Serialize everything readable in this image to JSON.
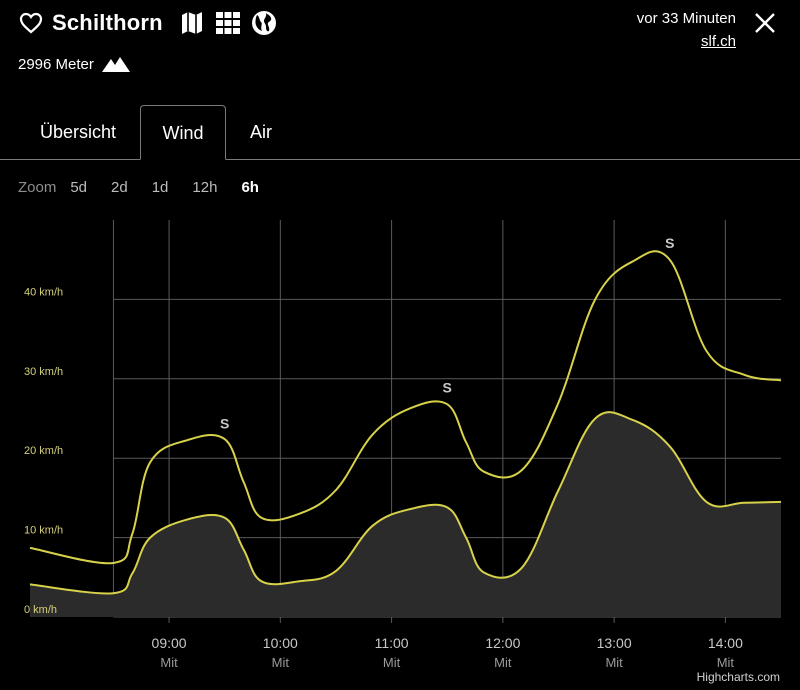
{
  "header": {
    "station_name": "Schilthorn",
    "altitude": "2996 Meter",
    "updated": "vor 33 Minuten",
    "source_link": "slf.ch",
    "icons": [
      "heart-icon",
      "map-icon",
      "grid-icon",
      "globe-icon",
      "mountain-icon",
      "close-icon"
    ]
  },
  "tabs": [
    {
      "label": "Übersicht",
      "active": false
    },
    {
      "label": "Wind",
      "active": true
    },
    {
      "label": "Air",
      "active": false
    }
  ],
  "zoom": {
    "label": "Zoom",
    "options": [
      "5d",
      "2d",
      "1d",
      "12h",
      "6h"
    ],
    "active": "6h"
  },
  "credits": "Highcharts.com",
  "colors": {
    "line": "#d8d24a",
    "area": "#2b2b2b",
    "grid": "#5a5a5a",
    "axis_text": "#d6d07a"
  },
  "chart_data": {
    "type": "line",
    "x_unit": "time",
    "x_ticks": [
      {
        "main": "09:00",
        "sub": "Mit"
      },
      {
        "main": "10:00",
        "sub": "Mit"
      },
      {
        "main": "11:00",
        "sub": "Mit"
      },
      {
        "main": "12:00",
        "sub": "Mit"
      },
      {
        "main": "13:00",
        "sub": "Mit"
      },
      {
        "main": "14:00",
        "sub": "Mit"
      }
    ],
    "x_ticks_hours": [
      9,
      10,
      11,
      12,
      13,
      14
    ],
    "xlim_hours": [
      7.75,
      14.5
    ],
    "y_ticks": [
      {
        "value": 0,
        "label": "0 km/h"
      },
      {
        "value": 10,
        "label": "10 km/h"
      },
      {
        "value": 20,
        "label": "20 km/h"
      },
      {
        "value": 30,
        "label": "30 km/h"
      },
      {
        "value": 40,
        "label": "40 km/h"
      }
    ],
    "ylim": [
      0,
      50
    ],
    "grid": true,
    "series": [
      {
        "kind": "gust",
        "points": [
          [
            7.75,
            8.7
          ],
          [
            8.5,
            6.8
          ],
          [
            8.67,
            10.5
          ],
          [
            8.83,
            19.5
          ],
          [
            9.17,
            22.3
          ],
          [
            9.5,
            22.4
          ],
          [
            9.67,
            17.0
          ],
          [
            9.83,
            12.5
          ],
          [
            10.17,
            13.0
          ],
          [
            10.5,
            16.0
          ],
          [
            10.83,
            23.0
          ],
          [
            11.17,
            26.3
          ],
          [
            11.5,
            26.8
          ],
          [
            11.67,
            22.0
          ],
          [
            11.83,
            18.3
          ],
          [
            12.17,
            18.5
          ],
          [
            12.5,
            27.0
          ],
          [
            12.83,
            40.0
          ],
          [
            13.17,
            44.8
          ],
          [
            13.5,
            45.0
          ],
          [
            13.83,
            33.5
          ],
          [
            14.17,
            30.5
          ],
          [
            14.5,
            29.8
          ]
        ]
      },
      {
        "kind": "mean",
        "points": [
          [
            7.75,
            4.1
          ],
          [
            8.5,
            3.0
          ],
          [
            8.67,
            5.5
          ],
          [
            8.83,
            10.0
          ],
          [
            9.17,
            12.3
          ],
          [
            9.5,
            12.5
          ],
          [
            9.67,
            8.5
          ],
          [
            9.83,
            4.5
          ],
          [
            10.17,
            4.5
          ],
          [
            10.5,
            5.8
          ],
          [
            10.83,
            11.5
          ],
          [
            11.17,
            13.6
          ],
          [
            11.5,
            13.8
          ],
          [
            11.67,
            10.0
          ],
          [
            11.83,
            5.6
          ],
          [
            12.17,
            6.2
          ],
          [
            12.5,
            16.0
          ],
          [
            12.83,
            25.0
          ],
          [
            13.17,
            24.8
          ],
          [
            13.5,
            21.5
          ],
          [
            13.83,
            14.5
          ],
          [
            14.17,
            14.4
          ],
          [
            14.5,
            14.5
          ]
        ]
      }
    ],
    "direction_labels": [
      {
        "x_hours": 9.5,
        "y": 23.5,
        "text": "S"
      },
      {
        "x_hours": 11.5,
        "y": 28.0,
        "text": "S"
      },
      {
        "x_hours": 13.5,
        "y": 46.2,
        "text": "S"
      }
    ]
  }
}
